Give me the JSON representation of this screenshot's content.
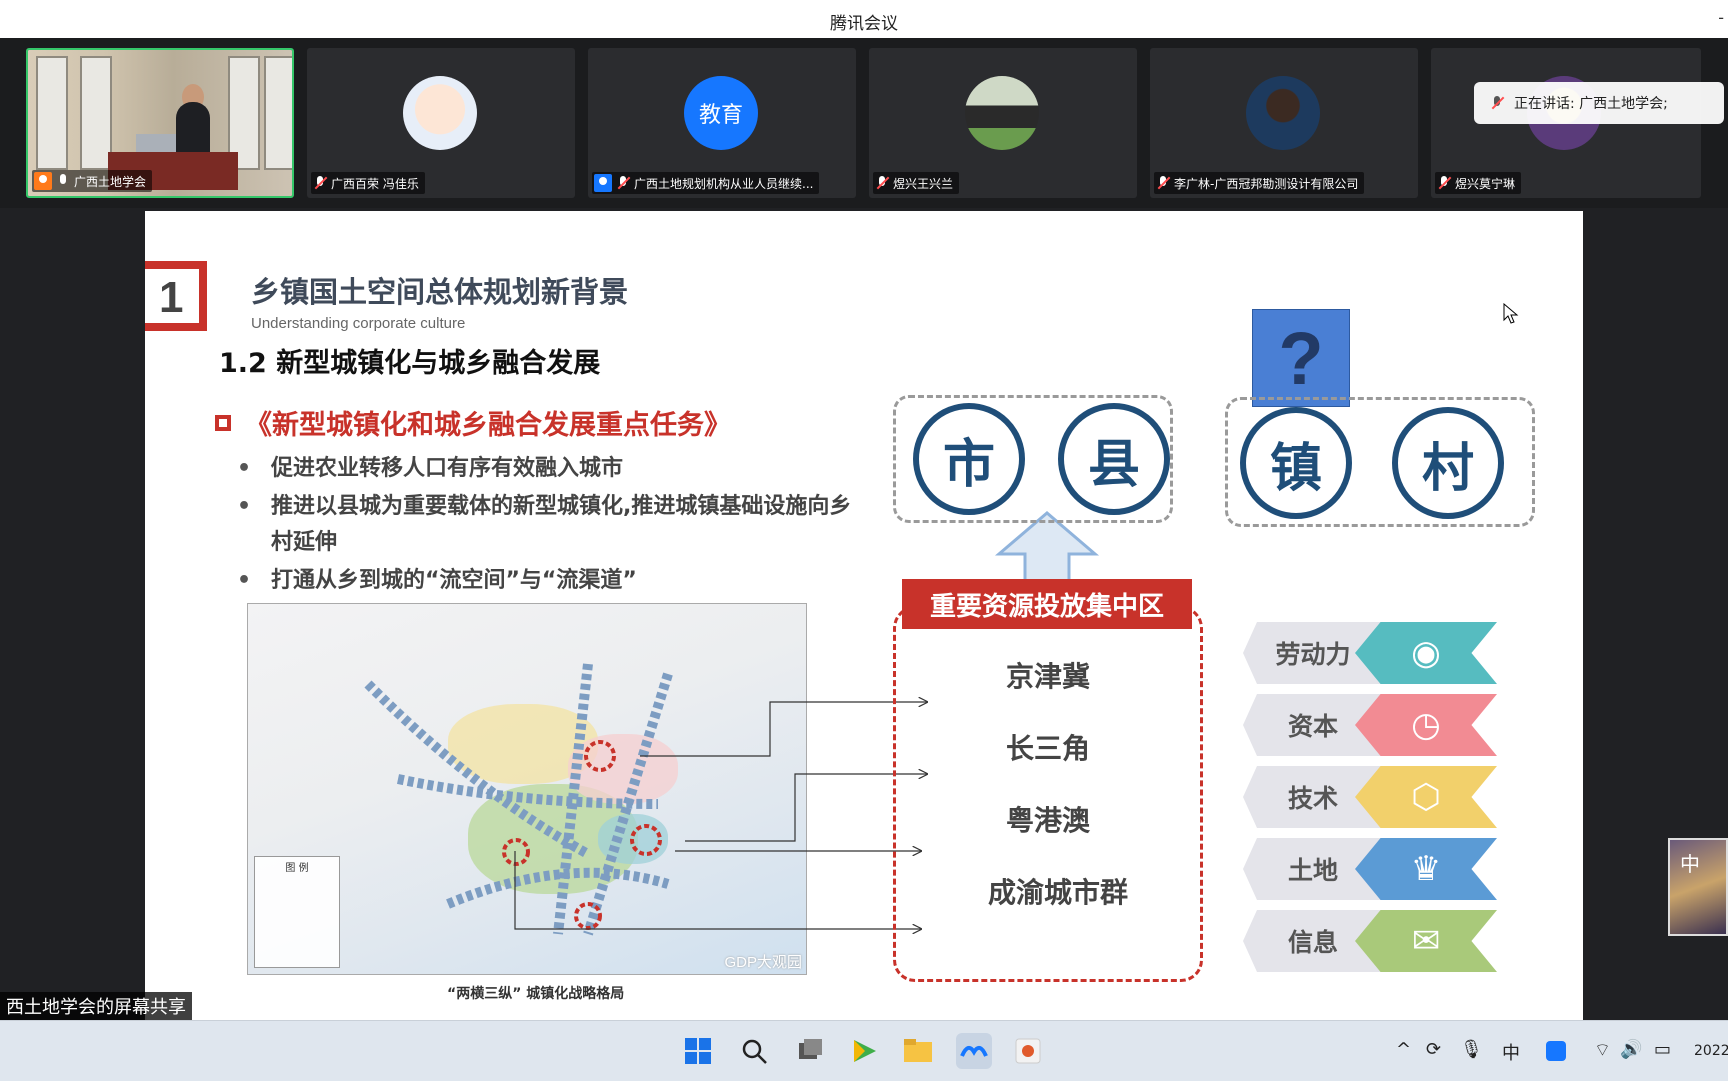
{
  "window": {
    "title": "腾讯会议",
    "minimize": "-"
  },
  "participants": [
    {
      "name": "广西土地学会",
      "mic": "on",
      "badge": "orange"
    },
    {
      "name": "广西百荣 冯佳乐",
      "mic": "off"
    },
    {
      "name": "广西土地规划机构从业人员继续...",
      "mic": "off",
      "badge": "blue",
      "avatar_text": "教育"
    },
    {
      "name": "煜兴王兴兰",
      "mic": "off"
    },
    {
      "name": "李广林-广西冠邦勘测设计有限公司",
      "mic": "off"
    },
    {
      "name": "煜兴莫宁琳",
      "mic": "off"
    }
  ],
  "speaking": {
    "text": "正在讲话: 广西土地学会;"
  },
  "slide": {
    "number": "1",
    "title": "乡镇国土空间总体规划新背景",
    "subtitle": "Understanding corporate culture",
    "section": "1.2  新型城镇化与城乡融合发展",
    "doc_title": "《新型城镇化和城乡融合发展重点任务》",
    "bullets": [
      "促进农业转移人口有序有效融入城市",
      "推进以县城为重要载体的新型城镇化,推进城镇基础设施向乡村延伸",
      "打通从乡到城的“流空间”与“流渠道”"
    ],
    "map_caption": "“两横三纵”  城镇化战略格局",
    "map_legend_title": "图 例",
    "map_watermark": "GDP大观园",
    "city_circles": [
      "市",
      "县"
    ],
    "town_circles": [
      "镇",
      "村"
    ],
    "question_mark": "?",
    "resources_header": "重要资源投放集中区",
    "resources": [
      "京津冀",
      "长三角",
      "粤港澳",
      "成渝城市群"
    ],
    "factors": [
      {
        "label": "劳动力",
        "icon": "eye-icon",
        "glyph": "◉",
        "color": "#56bcc0"
      },
      {
        "label": "资本",
        "icon": "clock-icon",
        "glyph": "◷",
        "color": "#f28b93"
      },
      {
        "label": "技术",
        "icon": "cube-icon",
        "glyph": "⬡",
        "color": "#f2d06b"
      },
      {
        "label": "土地",
        "icon": "trophy-icon",
        "glyph": "♛",
        "color": "#5b9bd5"
      },
      {
        "label": "信息",
        "icon": "mail-icon",
        "glyph": "✉",
        "color": "#a9c97a"
      }
    ]
  },
  "screen_share_label": "西土地学会的屏幕共享",
  "side_thumb": {
    "text": "中"
  },
  "tray": {
    "ime": "中",
    "clock_fragment": "2022"
  },
  "colors": {
    "accent_red": "#c8322a",
    "navy": "#1f4e79",
    "meeting_blue": "#1677ff"
  }
}
